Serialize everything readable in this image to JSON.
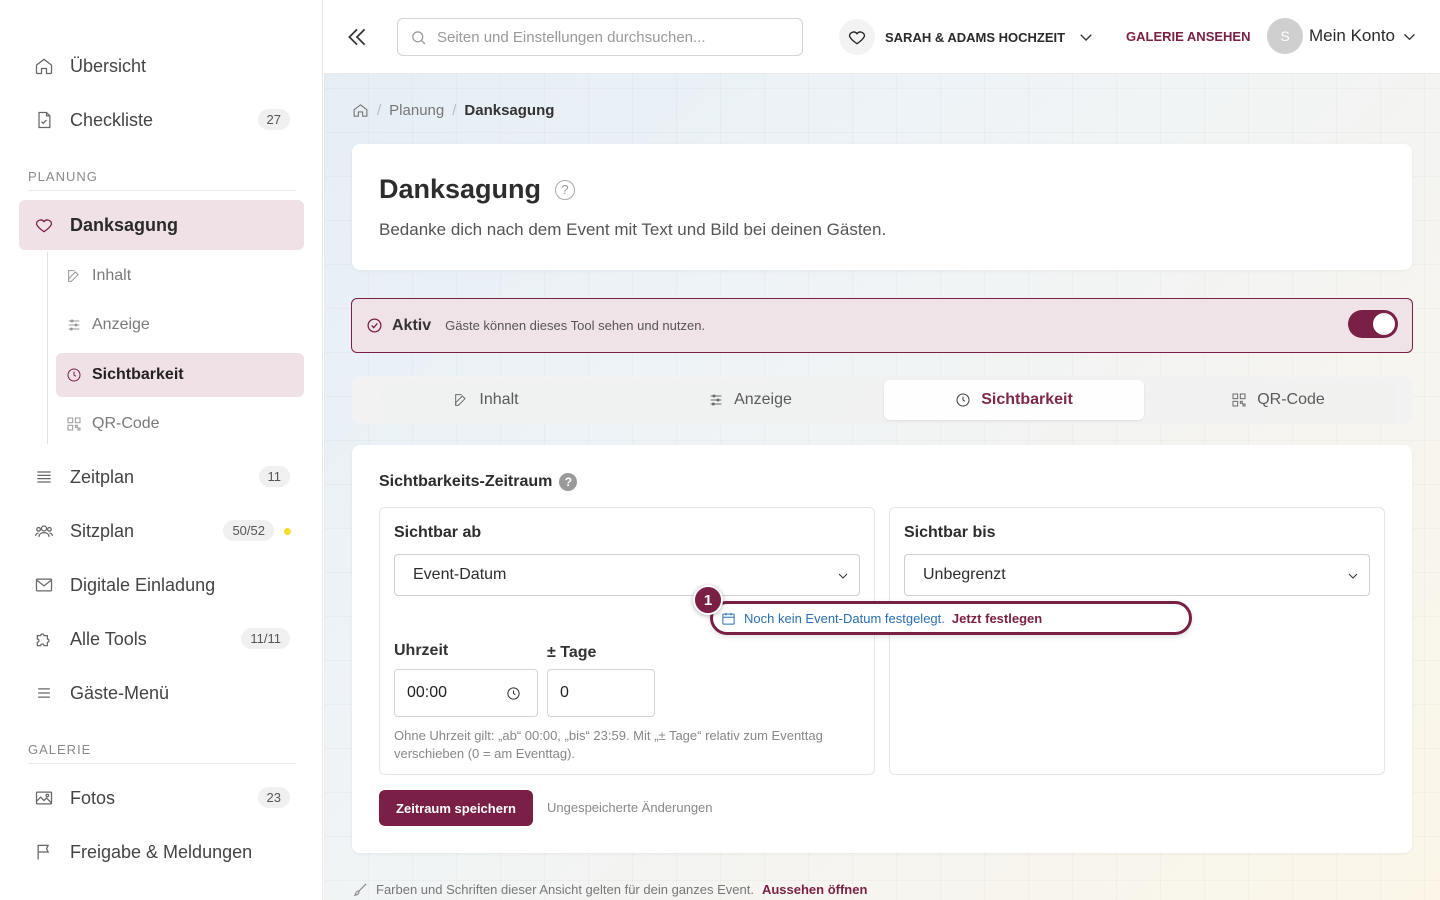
{
  "sidebar": {
    "top_items": [
      {
        "label": "Übersicht",
        "icon": "home-icon"
      },
      {
        "label": "Checkliste",
        "icon": "checklist-icon",
        "badge": "27"
      }
    ],
    "section_planning": "PLANUNG",
    "danksagung": {
      "label": "Danksagung",
      "icon": "heart-icon"
    },
    "sub_items": [
      {
        "label": "Inhalt",
        "icon": "edit-icon"
      },
      {
        "label": "Anzeige",
        "icon": "sliders-icon"
      },
      {
        "label": "Sichtbarkeit",
        "icon": "clock-icon"
      },
      {
        "label": "QR-Code",
        "icon": "qr-code-icon"
      }
    ],
    "planning_items": [
      {
        "label": "Zeitplan",
        "icon": "list-icon",
        "badge": "11"
      },
      {
        "label": "Sitzplan",
        "icon": "users-icon",
        "badge": "50/52"
      },
      {
        "label": "Digitale Einladung",
        "icon": "mail-icon"
      },
      {
        "label": "Alle Tools",
        "icon": "puzzle-icon",
        "badge": "11/11"
      },
      {
        "label": "Gäste-Menü",
        "icon": "menu-icon"
      }
    ],
    "section_gallery": "GALERIE",
    "gallery_items": [
      {
        "label": "Fotos",
        "icon": "image-icon",
        "badge": "23"
      },
      {
        "label": "Freigabe & Meldungen",
        "icon": "flag-icon"
      }
    ]
  },
  "topbar": {
    "search_placeholder": "Seiten und Einstellungen durchsuchen...",
    "event_name": "SARAH & ADAMS HOCHZEIT",
    "gallery_link": "GALERIE ANSEHEN",
    "avatar_initial": "S",
    "account_label": "Mein Konto"
  },
  "breadcrumb": {
    "parent": "Planung",
    "current": "Danksagung"
  },
  "header": {
    "title": "Danksagung",
    "subtitle": "Bedanke dich nach dem Event mit Text und Bild bei deinen Gästen."
  },
  "status": {
    "label": "Aktiv",
    "text": "Gäste können dieses Tool sehen und nutzen.",
    "enabled": true
  },
  "tabs": [
    {
      "label": "Inhalt",
      "icon": "edit-icon"
    },
    {
      "label": "Anzeige",
      "icon": "sliders-icon"
    },
    {
      "label": "Sichtbarkeit",
      "icon": "clock-icon"
    },
    {
      "label": "QR-Code",
      "icon": "qr-code-icon"
    }
  ],
  "visibility": {
    "title": "Sichtbarkeits-Zeitraum",
    "help": "?",
    "from": {
      "title": "Sichtbar ab",
      "selected": "Event-Datum",
      "notice_text": "Noch kein Event-Datum festgelegt.",
      "notice_action": "Jetzt festlegen",
      "marker": "1",
      "time_label": "Uhrzeit",
      "time_value": "00:00",
      "days_label": "± Tage",
      "days_value": "0",
      "hint": "Ohne Uhrzeit gilt: „ab“ 00:00, „bis“ 23:59. Mit „± Tage“ relativ zum Eventtag verschieben (0 = am Eventtag)."
    },
    "until": {
      "title": "Sichtbar bis",
      "selected": "Unbegrenzt"
    },
    "save_label": "Zeitraum speichern",
    "unsaved_label": "Ungespeicherte Änderungen"
  },
  "footer": {
    "text": "Farben und Schriften dieser Ansicht gelten für dein ganzes Event.",
    "link": "Aussehen öffnen"
  },
  "colors": {
    "accent": "#7a1f45",
    "accent_light": "#efe1e6",
    "link_blue": "#2a6fb0"
  }
}
